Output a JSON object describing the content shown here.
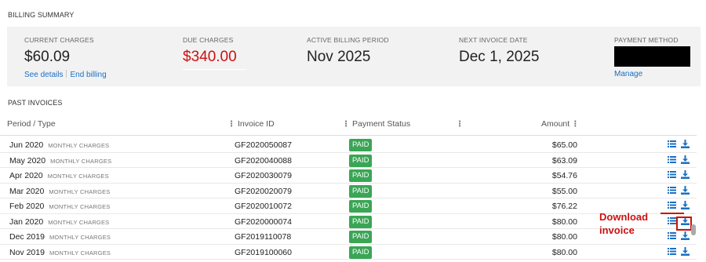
{
  "billing_summary": {
    "title": "BILLING SUMMARY",
    "current_charges": {
      "label": "CURRENT CHARGES",
      "value": "$60.09",
      "see_details": "See details",
      "end_billing": "End billing"
    },
    "due_charges": {
      "label": "DUE CHARGES",
      "value": "$340.00"
    },
    "active_period": {
      "label": "ACTIVE BILLING PERIOD",
      "value": "Nov 2025"
    },
    "next_invoice": {
      "label": "NEXT INVOICE DATE",
      "value": "Dec 1, 2025"
    },
    "payment_method": {
      "label": "PAYMENT METHOD",
      "manage": "Manage"
    }
  },
  "past_invoices": {
    "title": "PAST INVOICES",
    "columns": {
      "period": "Period / Type",
      "invoice_id": "Invoice ID",
      "status": "Payment Status",
      "amount": "Amount"
    },
    "rows": [
      {
        "period": "Jun 2020",
        "type": "MONTHLY CHARGES",
        "invoice_id": "GF2020050087",
        "status": "PAID",
        "amount": "$65.00"
      },
      {
        "period": "May 2020",
        "type": "MONTHLY CHARGES",
        "invoice_id": "GF2020040088",
        "status": "PAID",
        "amount": "$63.09"
      },
      {
        "period": "Apr 2020",
        "type": "MONTHLY CHARGES",
        "invoice_id": "GF2020030079",
        "status": "PAID",
        "amount": "$54.76"
      },
      {
        "period": "Mar 2020",
        "type": "MONTHLY CHARGES",
        "invoice_id": "GF2020020079",
        "status": "PAID",
        "amount": "$55.00"
      },
      {
        "period": "Feb 2020",
        "type": "MONTHLY CHARGES",
        "invoice_id": "GF2020010072",
        "status": "PAID",
        "amount": "$76.22"
      },
      {
        "period": "Jan 2020",
        "type": "MONTHLY CHARGES",
        "invoice_id": "GF2020000074",
        "status": "PAID",
        "amount": "$80.00"
      },
      {
        "period": "Dec 2019",
        "type": "MONTHLY CHARGES",
        "invoice_id": "GF2019110078",
        "status": "PAID",
        "amount": "$80.00"
      },
      {
        "period": "Nov 2019",
        "type": "MONTHLY CHARGES",
        "invoice_id": "GF2019100060",
        "status": "PAID",
        "amount": "$80.00"
      }
    ]
  },
  "annotation": {
    "line1": "Download",
    "line2": "invoice"
  },
  "colors": {
    "accent_link": "#1a6fc2",
    "due_red": "#cc1111",
    "paid_green": "#3aa655",
    "panel_bg": "#f2f2f2"
  },
  "icons": {
    "row_details": "list-icon",
    "row_download": "download-icon",
    "column_menu": "column-grip-icon"
  }
}
